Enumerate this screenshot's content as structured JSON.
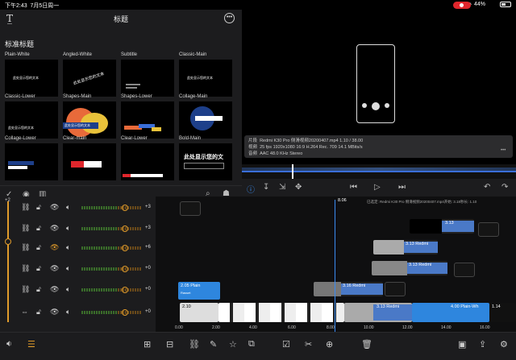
{
  "status": {
    "time": "下午2:43",
    "date": "7月5日周一",
    "battery": "44%"
  },
  "title_panel": {
    "title": "标题",
    "section": "标准标题",
    "tiles": [
      {
        "name": "Plain-White",
        "text": "此处显示您的文本"
      },
      {
        "name": "Angled-White",
        "text": "此处显示您的文本"
      },
      {
        "name": "Subtitle",
        "text": ""
      },
      {
        "name": "Classic-Main",
        "text": "此处显示您的文本"
      },
      {
        "name": "Classic-Lower",
        "text": "此处显示您的文本"
      },
      {
        "name": "Shapes-Main",
        "text": "此处显示您的文本"
      },
      {
        "name": "Shapes-Lower",
        "text": ""
      },
      {
        "name": "Collage-Main",
        "text": ""
      },
      {
        "name": "Collage-Lower",
        "text": ""
      },
      {
        "name": "Clear-main",
        "text": ""
      },
      {
        "name": "Clear-Lower",
        "text": ""
      },
      {
        "name": "Bold-Main",
        "text": "此处显示您的文"
      }
    ]
  },
  "info": {
    "row1_label": "片段",
    "row1": "Redmi K30 Pro 侧滑视频20200407.mp4  1.10 / 38.00",
    "row2_label": "视频",
    "row2": "25 fps  1920x1080  16:9  H.264 Rec. 709  14.1 MBits/s",
    "row3_label": "音频",
    "row3": "AAC  48.0 KHz  Stereo"
  },
  "timeline": {
    "playhead_time": "8.06",
    "top_right_text": "已选定: Redmi K30 Pro 侧滑视频20200407.mp4开始: 3.18秒长: 1.10",
    "track_values": [
      "+3",
      "+3",
      "+6",
      "+0",
      "+0",
      "+0"
    ],
    "vol_top": "+2",
    "ruler_ticks": [
      "0.00",
      "2.00",
      "4.00",
      "6.00",
      "8.00",
      "10.00",
      "12.00",
      "14.00",
      "16.00"
    ],
    "clips": {
      "title_clip": "2.05  Plain",
      "title_clip_sub": "Rasset",
      "upper_clip1": "3.13",
      "upper_clip2": "3.13  Redmi",
      "upper_clip3": "3.13  Redmi",
      "audio_clip": "3.16  Redmi",
      "main_clip1": "2.10",
      "main_clip2": "3.13  Redmi",
      "main_clip3": "4.00  Plain-Wh",
      "main_clip4": "1.14"
    }
  }
}
